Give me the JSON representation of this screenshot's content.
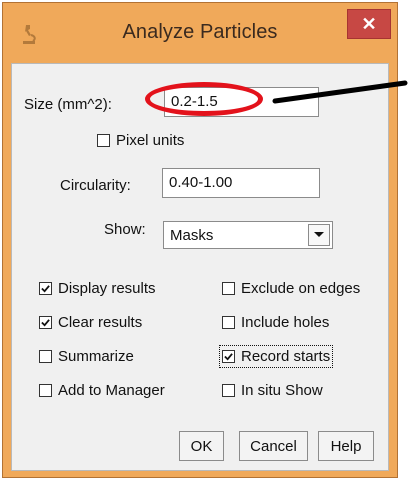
{
  "window": {
    "title": "Analyze Particles"
  },
  "fields": {
    "size": {
      "label": "Size (mm^2):",
      "value": "0.2-1.5"
    },
    "circularity": {
      "label": "Circularity:",
      "value": "0.40-1.00"
    }
  },
  "checkbox_pixel_units": {
    "label": "Pixel units",
    "checked": false
  },
  "show": {
    "label": "Show:",
    "selected": "Masks"
  },
  "options": [
    {
      "label": "Display results",
      "checked": true
    },
    {
      "label": "Exclude on edges",
      "checked": false
    },
    {
      "label": "Clear results",
      "checked": true
    },
    {
      "label": "Include holes",
      "checked": false
    },
    {
      "label": "Summarize",
      "checked": false
    },
    {
      "label": "Record starts",
      "checked": true
    },
    {
      "label": "Add to Manager",
      "checked": false
    },
    {
      "label": "In situ Show",
      "checked": false
    }
  ],
  "buttons": {
    "ok": "OK",
    "cancel": "Cancel",
    "help": "Help"
  },
  "icons": {
    "close": "close-icon",
    "app": "microscope-icon",
    "dropdown": "chevron-down-icon"
  }
}
